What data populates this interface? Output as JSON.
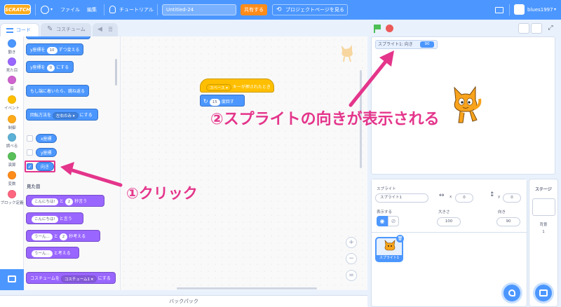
{
  "menubar": {
    "logo": "SCRATCH",
    "file": "ファイル",
    "edit": "編集",
    "tutorial": "チュートリアル",
    "project_title": "Untitled-24",
    "share": "共有する",
    "project_page": "プロジェクトページを見る",
    "username": "blues1997"
  },
  "tabs": {
    "code": "コード",
    "costume": "コスチューム",
    "sound": "音"
  },
  "categories": [
    {
      "label": "動き",
      "color": "#4c97ff"
    },
    {
      "label": "見た目",
      "color": "#9966ff"
    },
    {
      "label": "音",
      "color": "#cf63cf"
    },
    {
      "label": "イベント",
      "color": "#ffbf00"
    },
    {
      "label": "制御",
      "color": "#ffab19"
    },
    {
      "label": "調べる",
      "color": "#5cb1d6"
    },
    {
      "label": "演算",
      "color": "#59c059"
    },
    {
      "label": "変数",
      "color": "#ff8c1a"
    },
    {
      "label": "ブロック定義",
      "color": "#ff6680"
    }
  ],
  "palette": {
    "change_y": {
      "pre": "y座標を",
      "val": "10",
      "post": "ずつ変える"
    },
    "set_y": {
      "pre": "y座標を",
      "val": "0",
      "post": "にする"
    },
    "bounce": "もし端に着いたら、跳ね返る",
    "rotation_style": {
      "pre": "回転方法を",
      "val": "左右のみ ▾",
      "post": "にする"
    },
    "x_reporter": "x座標",
    "y_reporter": "y座標",
    "direction_reporter": "向き",
    "looks_heading": "見た目",
    "say_for": {
      "val1": "こんにちは!",
      "mid": "と",
      "val2": "2",
      "post": "秒言う"
    },
    "say": {
      "val1": "こんにちは!",
      "post": "と言う"
    },
    "think_for": {
      "val1": "うーん...",
      "mid": "と",
      "val2": "2",
      "post": "秒考える"
    },
    "think": {
      "val1": "うーん...",
      "post": "と考える"
    },
    "switch_costume": {
      "pre": "コスチュームを",
      "val": "コスチューム1 ▾",
      "post": "にする"
    }
  },
  "script": {
    "hat_key": "スペース ▾",
    "hat_text": "キーが押されたとき",
    "turn_val": "15",
    "turn_text": "度回す"
  },
  "zoom": {
    "in": "+",
    "out": "−",
    "reset": "="
  },
  "backpack": "バックパック",
  "monitor": {
    "label": "スプライト1: 向き",
    "value": "90"
  },
  "sprite_info": {
    "sprite_label": "スプライト",
    "sprite_name": "スプライト1",
    "x_label": "x",
    "x_value": "0",
    "y_label": "y",
    "y_value": "0",
    "show_label": "表示する",
    "size_label": "大きさ",
    "size_value": "100",
    "direction_label": "向き",
    "direction_value": "90",
    "thumb_label": "スプライト1"
  },
  "stage_pane": {
    "title": "ステージ",
    "backdrop_label": "背景",
    "backdrop_count": "1"
  },
  "annotations": {
    "click": "①クリック",
    "direction_shown": "②スプライトの向きが表示される",
    "color": "#e4358b"
  }
}
